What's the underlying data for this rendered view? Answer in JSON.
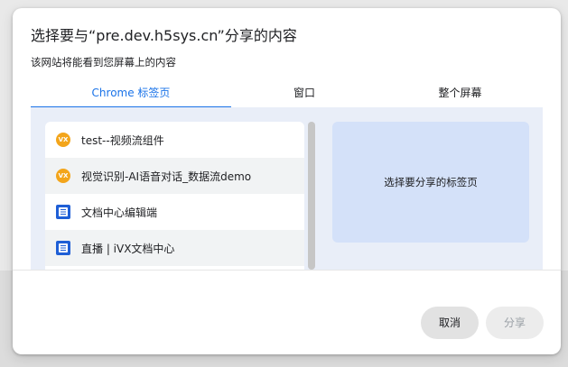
{
  "dialog": {
    "title": "选择要与“pre.dev.h5sys.cn”分享的内容",
    "subtitle": "该网站将能看到您屏幕上的内容"
  },
  "tabs": [
    {
      "label": "Chrome 标签页",
      "active": true
    },
    {
      "label": "窗口",
      "active": false
    },
    {
      "label": "整个屏幕",
      "active": false
    }
  ],
  "tab_list": [
    {
      "label": "test--视频流组件",
      "icon": "ivx-favicon-icon",
      "icon_text": "VX"
    },
    {
      "label": "视觉识别-AI语音对话_数据流demo",
      "icon": "ivx-favicon-icon",
      "icon_text": "VX"
    },
    {
      "label": "文档中心编辑端",
      "icon": "document-favicon-icon"
    },
    {
      "label": "直播 | iVX文档中心",
      "icon": "document-favicon-icon"
    }
  ],
  "preview": {
    "placeholder": "选择要分享的标签页"
  },
  "buttons": {
    "cancel": "取消",
    "share": "分享"
  },
  "colors": {
    "accent": "#1a73e8",
    "preview_bg": "#d4e1f9",
    "content_bg": "#e9eef8",
    "vx_icon": "#f3a51b",
    "doc_icon": "#1f5fd6"
  }
}
